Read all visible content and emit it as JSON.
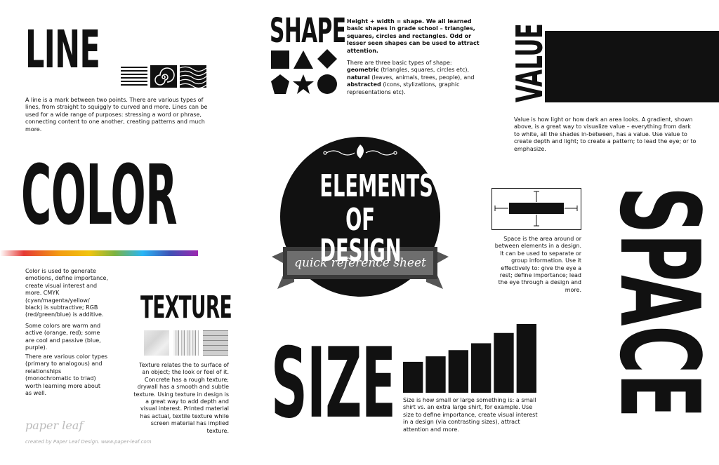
{
  "line": {
    "title": "LINE",
    "text": "A line is a mark between two points. There are various types of lines, from straight to squiggly to curved and more. Lines can be used for a wide range of purposes: stressing a word or phrase, connecting content to one another, creating patterns and much more.",
    "swatches": [
      "lines-swatch",
      "spiral-swatch",
      "wave-swatch"
    ]
  },
  "shape": {
    "title": "SHAPE",
    "text1": "Height + width = shape. We all learned basic shapes in grade school – triangles, squares, circles and rectangles. Odd or lesser seen shapes can be used to attract attention.",
    "text2_intro": "There are three basic types of shape:",
    "geometric_label": "geometric",
    "geometric_rest": " (triangles, squares, circles etc),",
    "natural_label": "natural",
    "natural_rest": " (leaves, animals, trees, people), and",
    "abstracted_label": "abstracted",
    "abstracted_rest": " (icons, stylizations, graphic representations etc)."
  },
  "value": {
    "title": "VALUE",
    "text": "Value is how light or how dark an area looks. A gradient, shown above, is a great way to visualize value – everything from dark to white, all the shades in-between, has a value. Use value to create depth and light; to create a pattern; to lead the eye; or to emphasize."
  },
  "color": {
    "title": "COLOR",
    "p1": "Color is used to generate emotions, define importance, create visual interest and more. CMYK (cyan/magenta/yellow/ black) is subtractive; RGB (red/green/blue) is additive.",
    "p2": "Some colors are warm and active (orange, red); some are cool and passive (blue, purple).",
    "p3": "There are various color types (primary to analogous) and relationships (monochromatic to triad) worth learning more about as well."
  },
  "texture": {
    "title": "TEXTURE",
    "text": "Texture relates the to surface of an object; the look or feel of it. Concrete has a rough texture; drywall has a smooth and subtle texture. Using texture in design is a great way to add depth and visual interest. Printed material has actual, textile texture while screen material has implied texture."
  },
  "size": {
    "title": "SIZE",
    "text": "Size is how small or large something is: a small shirt vs. an extra large shirt, for example. Use size to define importance, create visual interest in a design (via contrasting sizes), attract attention and more.",
    "bar_levels": [
      0.45,
      0.53,
      0.62,
      0.72,
      0.87,
      1.0
    ]
  },
  "space": {
    "title": "SPACE",
    "text": "Space is the area around or between elements in a design. It can be used to separate or group information. Use it effectively to: give the eye a rest; define importance; lead the eye through a design and more."
  },
  "center": {
    "title_line1": "ELEMENTS",
    "title_line2": "OF DESIGN",
    "banner": "quick reference sheet"
  },
  "footer": {
    "logo": "paper leaf",
    "credit": "created by Paper Leaf Design. www.paper-leaf.com"
  },
  "colors": {
    "black": "#111111",
    "banner_gray": "#6e6e6e",
    "banner_dark": "#3a3a3a"
  }
}
